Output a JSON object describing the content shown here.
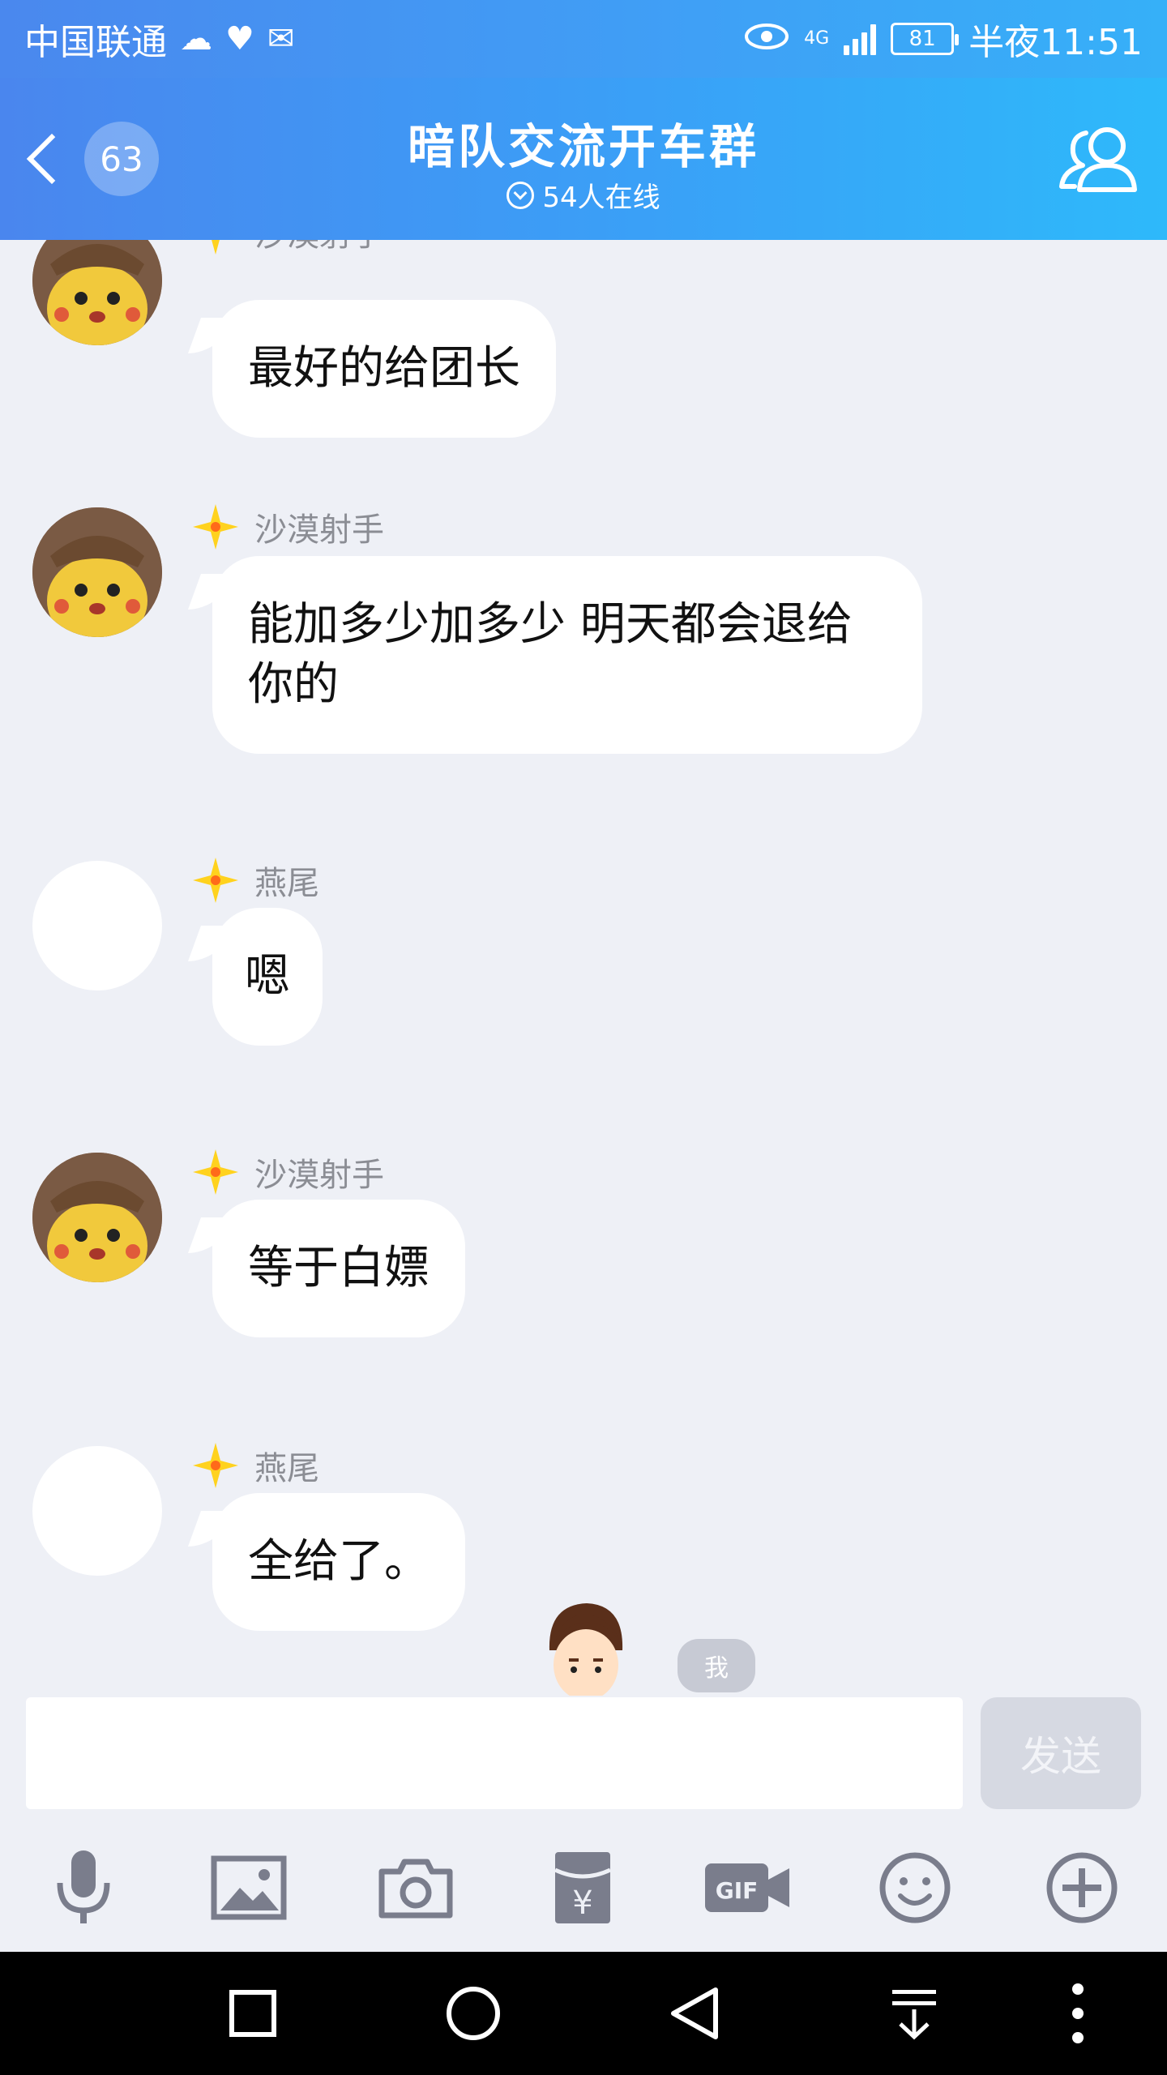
{
  "status_bar": {
    "carrier": "中国联通",
    "time": "半夜11:51",
    "battery": "81",
    "network": "4G",
    "icons": [
      "cloud-icon",
      "heart-monitor-icon",
      "mail-icon",
      "eye-icon",
      "signal-icon",
      "battery-icon"
    ]
  },
  "header": {
    "back_count": "63",
    "title": "暗队交流开车群",
    "online": "54人在线",
    "members_icon": "group-members-icon"
  },
  "messages": [
    {
      "sender": "沙漠射手",
      "text": "最好的给团长",
      "avatar": "pikachu-detective"
    },
    {
      "sender": "沙漠射手",
      "text": "能加多少加多少  明天都会退给你的",
      "avatar": "pikachu-detective"
    },
    {
      "sender": "燕尾",
      "text": "嗯",
      "avatar": "blank"
    },
    {
      "sender": "沙漠射手",
      "text": "等于白嫖",
      "avatar": "pikachu-detective"
    },
    {
      "sender": "燕尾",
      "text": "全给了。",
      "avatar": "blank"
    }
  ],
  "me_tag": "我",
  "input": {
    "value": "",
    "placeholder": "",
    "send_label": "发送"
  },
  "toolbar": [
    "microphone-icon",
    "image-icon",
    "camera-icon",
    "red-packet-icon",
    "gif-video-icon",
    "emoji-icon",
    "plus-icon"
  ],
  "nav": [
    "recent-apps-icon",
    "home-icon",
    "back-icon",
    "notification-pull-icon",
    "more-icon"
  ],
  "colors": {
    "header_start": "#4a86ee",
    "header_end": "#2eb9fa",
    "chat_bg": "#eef0f6",
    "bubble": "#ffffff",
    "send_disabled": "#d6d9e2"
  }
}
